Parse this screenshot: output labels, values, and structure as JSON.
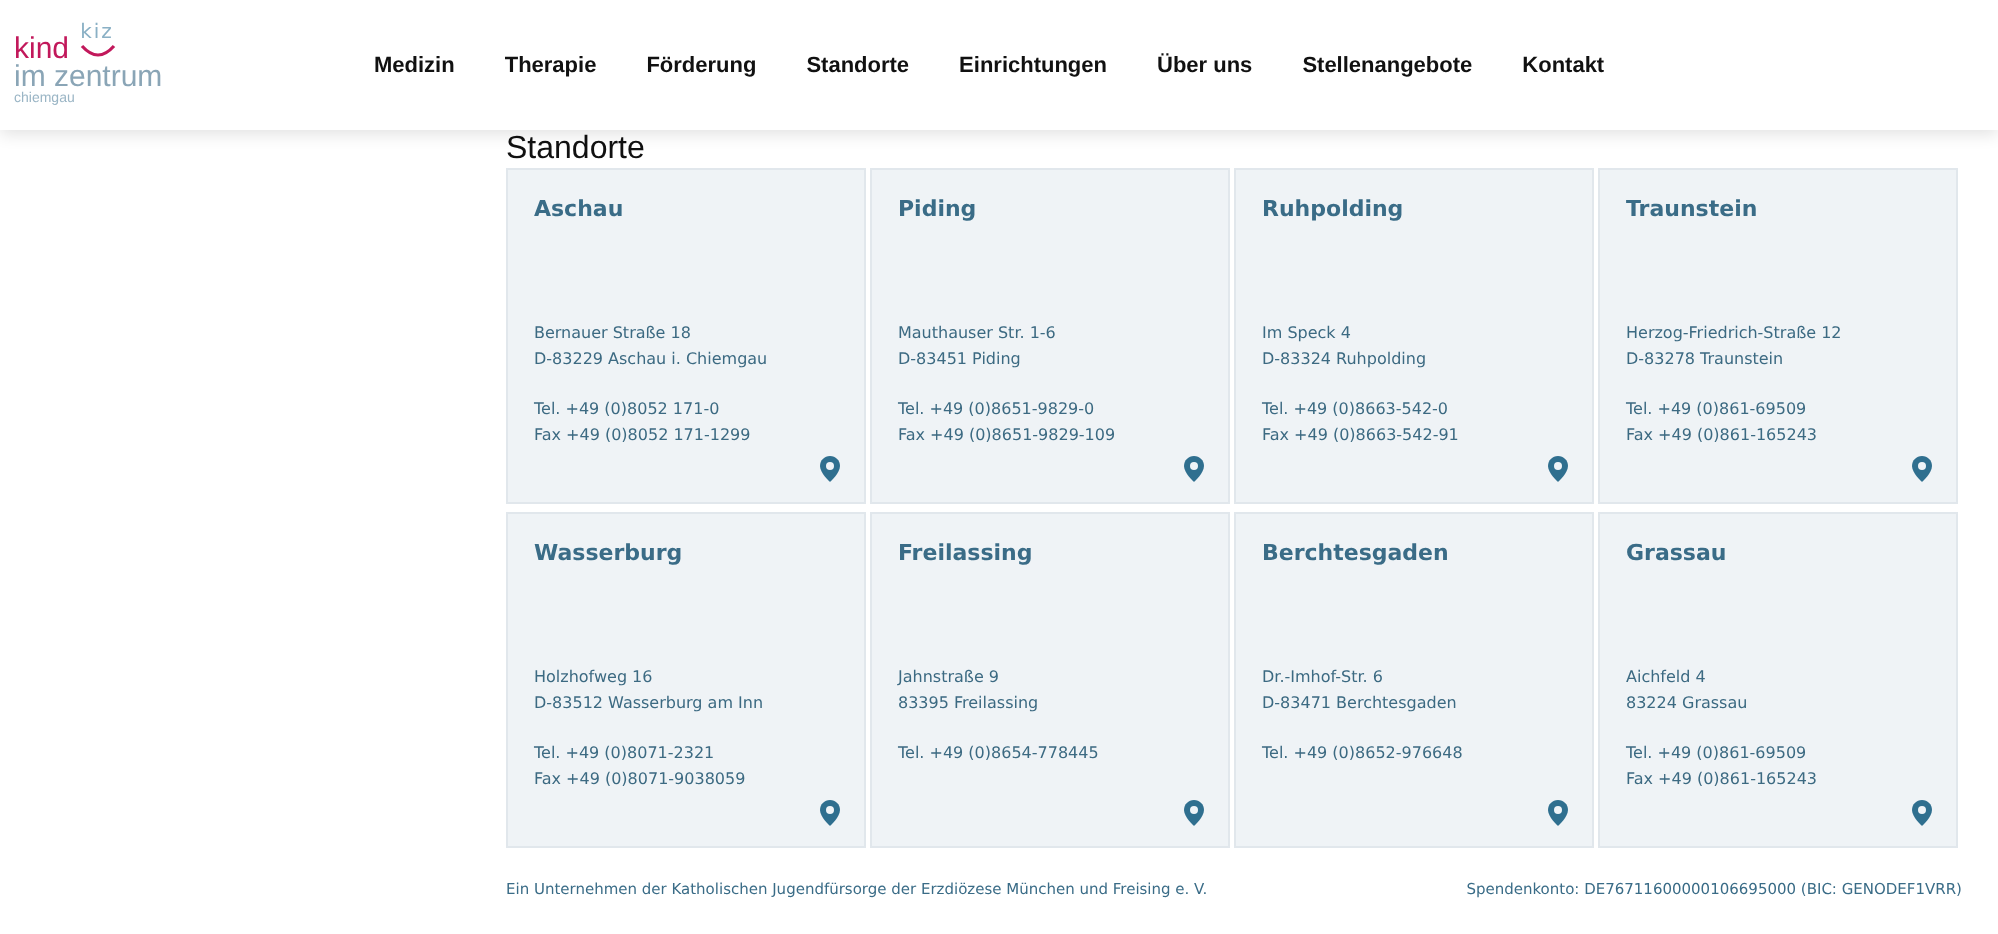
{
  "logo": {
    "mark": "kiz",
    "line_1": "kind",
    "line_2": "im zentrum",
    "line_3": "chiemgau"
  },
  "nav": [
    {
      "label": "Medizin"
    },
    {
      "label": "Therapie"
    },
    {
      "label": "Förderung"
    },
    {
      "label": "Standorte"
    },
    {
      "label": "Einrichtungen"
    },
    {
      "label": "Über uns"
    },
    {
      "label": "Stellenangebote"
    },
    {
      "label": "Kontakt"
    }
  ],
  "heading": "Standorte",
  "locations": [
    {
      "name": "Aschau",
      "address": [
        "Bernauer Straße 18",
        "D-83229 Aschau i. Chiemgau"
      ],
      "contact": [
        "Tel. +49 (0)8052 171-0",
        "Fax +49 (0)8052 171-1299"
      ]
    },
    {
      "name": "Piding",
      "address": [
        "Mauthauser Str. 1-6",
        "D-83451 Piding"
      ],
      "contact": [
        "Tel. +49 (0)8651-9829-0",
        "Fax +49 (0)8651-9829-109"
      ]
    },
    {
      "name": "Ruhpolding",
      "address": [
        "Im Speck 4",
        "D-83324 Ruhpolding"
      ],
      "contact": [
        "Tel. +49 (0)8663-542-0",
        "Fax +49 (0)8663-542-91"
      ]
    },
    {
      "name": "Traunstein",
      "address": [
        "Herzog-Friedrich-Straße 12",
        "D-83278 Traunstein"
      ],
      "contact": [
        "Tel. +49 (0)861-69509",
        "Fax +49 (0)861-165243"
      ]
    },
    {
      "name": "Wasserburg",
      "address": [
        "Holzhofweg 16",
        "D-83512 Wasserburg am Inn"
      ],
      "contact": [
        "Tel. +49 (0)8071-2321",
        "Fax +49 (0)8071-9038059"
      ]
    },
    {
      "name": "Freilassing",
      "address": [
        "Jahnstraße 9",
        "83395 Freilassing"
      ],
      "contact": [
        "Tel. +49 (0)8654-778445"
      ]
    },
    {
      "name": "Berchtesgaden",
      "address": [
        "Dr.-Imhof-Str. 6",
        "D-83471 Berchtesgaden"
      ],
      "contact": [
        "Tel. +49 (0)8652-976648"
      ]
    },
    {
      "name": "Grassau",
      "address": [
        "Aichfeld 4",
        "83224 Grassau"
      ],
      "contact": [
        "Tel. +49 (0)861-69509",
        "Fax +49 (0)861-165243"
      ]
    }
  ],
  "footer": {
    "left": "Ein Unternehmen der Katholischen Jugendfürsorge der Erzdiözese München und Freising e. V.",
    "right": "Spendenkonto: DE76711600000106695000 (BIC: GENODEF1VRR)"
  }
}
